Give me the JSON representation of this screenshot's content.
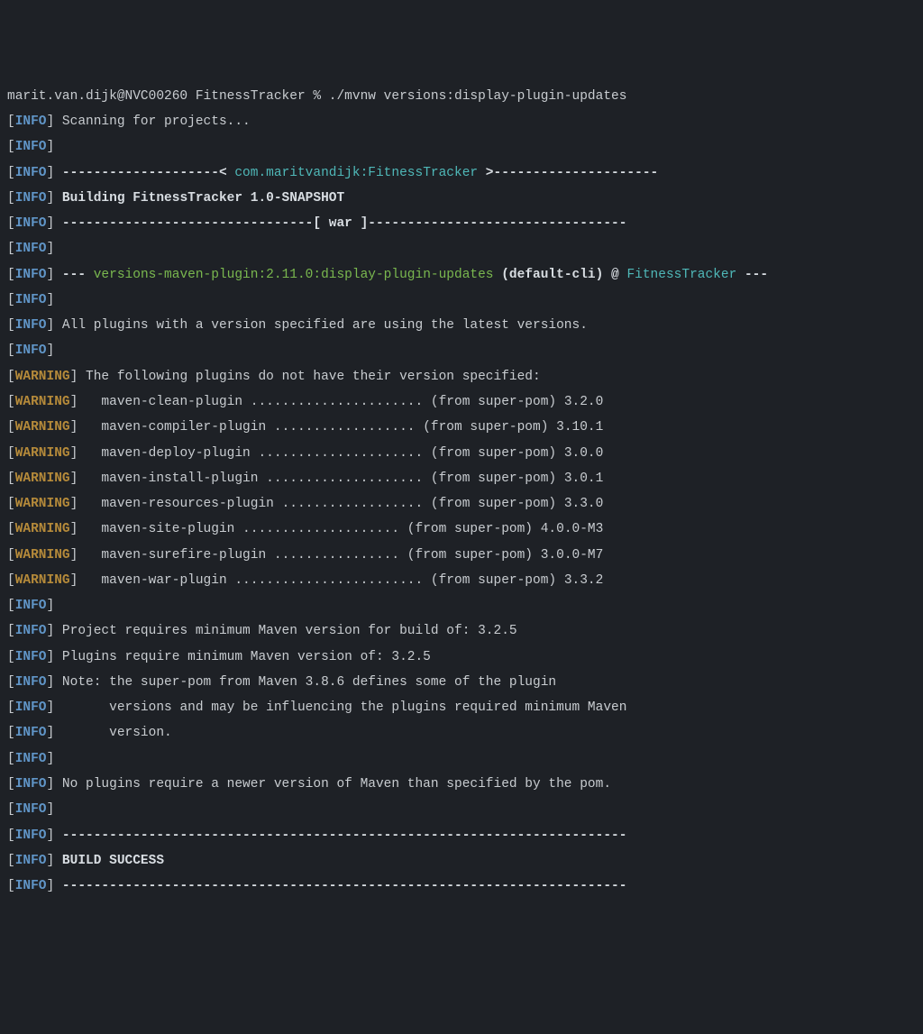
{
  "tags": {
    "info": "INFO",
    "warning": "WARNING"
  },
  "prompt": {
    "user_host": "marit.van.dijk@NVC00260",
    "dir": "FitnessTracker",
    "sep": "%",
    "cmd": "./mvnw versions:display-plugin-updates"
  },
  "scanning": "Scanning for projects...",
  "rule_open": " --------------------< ",
  "artifact": "com.maritvandijk:FitnessTracker",
  "rule_close": " >---------------------",
  "building": "Building FitnessTracker 1.0-SNAPSHOT",
  "packaging_line": " --------------------------------[ war ]---------------------------------",
  "goal_line": {
    "pre": " --- ",
    "goal": "versions-maven-plugin:2.11.0:display-plugin-updates",
    "exec": " (default-cli)",
    "at": " @ ",
    "project": "FitnessTracker",
    "post": " ---"
  },
  "latest_line": " All plugins with a version specified are using the latest versions.",
  "no_version_header": " The following plugins do not have their version specified:",
  "plugins": [
    "   maven-clean-plugin ...................... (from super-pom) 3.2.0",
    "   maven-compiler-plugin .................. (from super-pom) 3.10.1",
    "   maven-deploy-plugin ..................... (from super-pom) 3.0.0",
    "   maven-install-plugin .................... (from super-pom) 3.0.1",
    "   maven-resources-plugin .................. (from super-pom) 3.3.0",
    "   maven-site-plugin .................... (from super-pom) 4.0.0-M3",
    "   maven-surefire-plugin ................ (from super-pom) 3.0.0-M7",
    "   maven-war-plugin ........................ (from super-pom) 3.3.2"
  ],
  "req_build": " Project requires minimum Maven version for build of: 3.2.5",
  "req_plugins": " Plugins require minimum Maven version of: 3.2.5",
  "note1": " Note: the super-pom from Maven 3.8.6 defines some of the plugin",
  "note2": "       versions and may be influencing the plugins required minimum Maven",
  "note3": "       version.",
  "no_newer": " No plugins require a newer version of Maven than specified by the pom.",
  "rule_full": " ------------------------------------------------------------------------",
  "build_success": "BUILD SUCCESS"
}
